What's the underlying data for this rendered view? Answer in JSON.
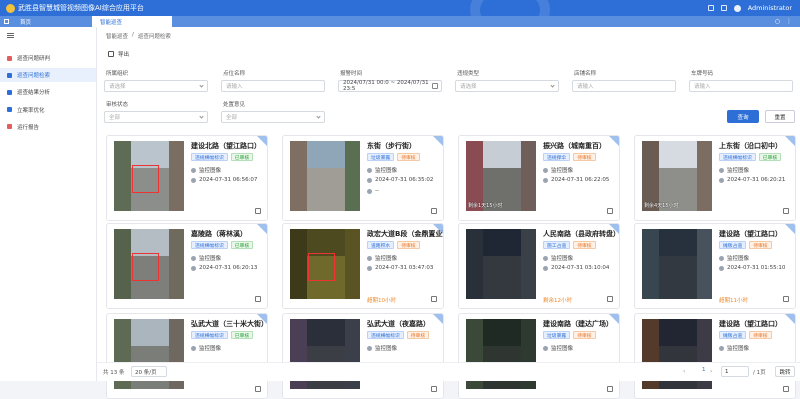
{
  "app": {
    "title": "武胜县智慧城管视频图像AI综合应用平台",
    "user": "Administrator"
  },
  "tabs": [
    {
      "label": "首页"
    },
    {
      "label": "智能巡查"
    }
  ],
  "sidebar": {
    "items": [
      {
        "label": "巡查问题研判",
        "color": "#e35d5d"
      },
      {
        "label": "巡查问题检索",
        "color": "#2d6fd6"
      },
      {
        "label": "巡查结果分析",
        "color": "#2d6fd6"
      },
      {
        "label": "立案率优化",
        "color": "#2d6fd6"
      },
      {
        "label": "运行报告",
        "color": "#e35d5d"
      }
    ]
  },
  "breadcrumb": {
    "parent": "智能巡查",
    "sep": "/",
    "current": "巡查问题检索"
  },
  "toolbar": {
    "export_label": "导出"
  },
  "filters": {
    "org": {
      "label": "所属组织",
      "placeholder": "请选择"
    },
    "point": {
      "label": "点位名称",
      "placeholder": "请输入"
    },
    "time": {
      "label": "报警时间",
      "value": "2024/07/31 00:0 ~ 2024/07/31 23:5"
    },
    "type": {
      "label": "违规类型",
      "placeholder": "请选择"
    },
    "shop": {
      "label": "店铺名称",
      "placeholder": "请输入"
    },
    "plate": {
      "label": "车牌号码",
      "placeholder": "请输入"
    },
    "audit": {
      "label": "审核状态",
      "value": "全部"
    },
    "handle": {
      "label": "处置意见",
      "value": "全部"
    },
    "search_label": "查询",
    "reset_label": "重置"
  },
  "cards": [
    {
      "title": "建设北路（望江路口）",
      "type": "违规横幅标识",
      "status": "已审核",
      "status_kind": "green",
      "source": "监控图像",
      "time": "2024-07-31 06:56:07",
      "deadline": ""
    },
    {
      "title": "东街（步行街）",
      "type": "垃圾暴露",
      "status": "待审核",
      "status_kind": "orange",
      "source": "监控图像",
      "time": "2024-07-31 06:35:02",
      "extra": "--",
      "deadline": ""
    },
    {
      "title": "振兴路（城南重百）",
      "type": "违规撑伞",
      "status": "待审核",
      "status_kind": "orange",
      "source": "监控图像",
      "time": "2024-07-31 06:22:05",
      "overlay": "剩余1天15小时"
    },
    {
      "title": "上东街（沿口初中）",
      "type": "违规横幅标识",
      "status": "已审核",
      "status_kind": "green",
      "source": "监控图像",
      "time": "2024-07-31 06:20:21",
      "overlay": "剩余4天15小时"
    },
    {
      "title": "嘉陵路（蒋林溪）",
      "type": "违规横幅标识",
      "status": "已审核",
      "status_kind": "green",
      "source": "监控图像",
      "time": "2024-07-31 06:20:13",
      "deadline": ""
    },
    {
      "title": "政宏大道B段（金鼎置业）",
      "type": "道路积水",
      "status": "待审核",
      "status_kind": "orange",
      "source": "监控图像",
      "time": "2024-07-31 03:47:03",
      "deadline": "超期10小时"
    },
    {
      "title": "人民南路（县政府转盘）",
      "type": "施工占道",
      "status": "待审核",
      "status_kind": "orange",
      "source": "监控图像",
      "time": "2024-07-31 03:10:04",
      "deadline": "剩余12小时"
    },
    {
      "title": "建设路（望江路口）",
      "type": "摊贩占道",
      "status": "待审核",
      "status_kind": "orange",
      "source": "监控图像",
      "time": "2024-07-31 01:55:10",
      "deadline": "超期11小时"
    },
    {
      "title": "弘武大道（三十米大街）",
      "type": "违规横幅标识",
      "status": "已审核",
      "status_kind": "green",
      "source": "监控图像",
      "time": "",
      "deadline": ""
    },
    {
      "title": "弘武大道（夜嘉路）",
      "type": "违规横幅标识",
      "status": "待审核",
      "status_kind": "orange",
      "source": "监控图像",
      "time": "",
      "deadline": ""
    },
    {
      "title": "建设南路（建达广场）",
      "type": "垃圾暴露",
      "status": "待审核",
      "status_kind": "orange",
      "source": "监控图像",
      "time": "",
      "deadline": ""
    },
    {
      "title": "建设路（望江路口）",
      "type": "摊贩占道",
      "status": "待审核",
      "status_kind": "orange",
      "source": "监控图像",
      "time": "",
      "deadline": ""
    }
  ],
  "pager": {
    "total": "共 13 条",
    "size": "20 条/页",
    "prev": "‹",
    "page": "1",
    "next": "›",
    "input": "1",
    "of": "/ 1页",
    "go": "跳转"
  }
}
